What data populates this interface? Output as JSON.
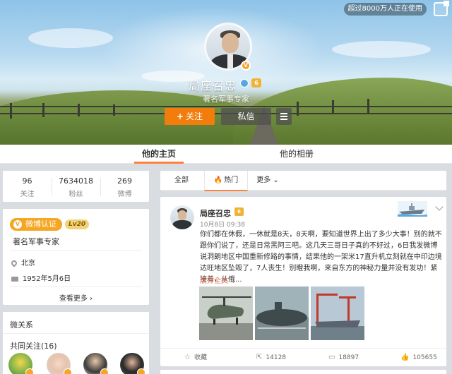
{
  "header": {
    "user_count": "超过8000万人正在使用"
  },
  "profile": {
    "name": "局座召忠",
    "description": "著名军事专家",
    "follow_label": "关注",
    "follow_plus": "+",
    "message_label": "私信",
    "v_mark": "V",
    "level_mark": "6"
  },
  "tabs": {
    "home": "他的主页",
    "album": "他的相册"
  },
  "stats": [
    {
      "value": "96",
      "label": "关注"
    },
    {
      "value": "7634018",
      "label": "粉丝"
    },
    {
      "value": "269",
      "label": "微博"
    }
  ],
  "info": {
    "verified_label": "微博认证",
    "level_label": "Lv20",
    "title": "著名军事专家",
    "location": "北京",
    "birthday": "1952年5月6日",
    "more": "查看更多 ›"
  },
  "relations": {
    "title": "微关系",
    "mutual": "共同关注(16)"
  },
  "feed_tabs": {
    "all": "全部",
    "hot": "热门",
    "hot_icon": "🔥",
    "more": "更多"
  },
  "post": {
    "author": "局座召忠",
    "badge": "6",
    "time": "10月8日 09:38",
    "text": "你们都在休假，一休就是8天，8天啊，要知道世界上出了多少大事！别的就不跟你们说了，还是日常黑阿三吧。这几天三哥日子真的不好过，6日我发微博说洞朗地区中国重新修路的事情，结果他的一架米17直升机立刻就在中印边境达旺地区坠毁了，7人丧生！别瞪我啊，来自东方的神秘力量并没有发功！紧接着，从俄...",
    "expand": "展开全文",
    "actions": {
      "favorite": "收藏",
      "repost": "14128",
      "comment": "18897",
      "like": "105655"
    }
  },
  "colors": {
    "accent": "#ff8140",
    "follow_button": "#f27d0c",
    "verified_badge": "#f5a623",
    "link": "#eb7350"
  }
}
